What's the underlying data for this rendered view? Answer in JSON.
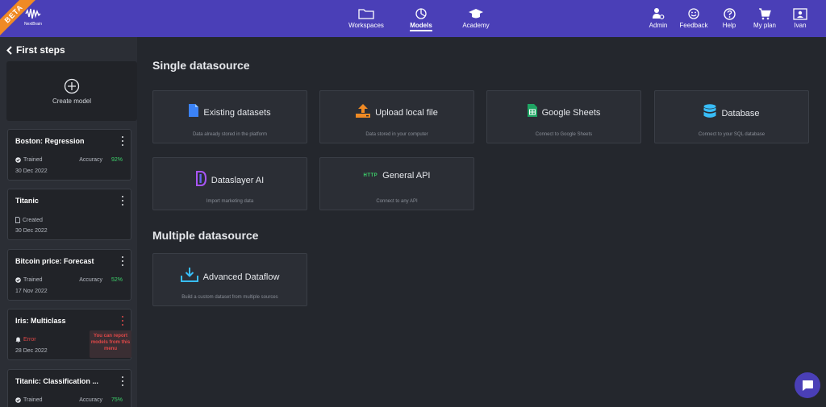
{
  "header": {
    "beta": "BETA",
    "logo_text": "NextBrain",
    "nav": [
      {
        "label": "Workspaces"
      },
      {
        "label": "Models"
      },
      {
        "label": "Academy"
      }
    ],
    "right": [
      {
        "label": "Admin"
      },
      {
        "label": "Feedback"
      },
      {
        "label": "Help"
      },
      {
        "label": "My plan"
      },
      {
        "label": "Ivan"
      }
    ]
  },
  "sidebar": {
    "title": "First steps",
    "create_label": "Create model",
    "models": [
      {
        "name": "Boston: Regression",
        "status": "Trained",
        "accuracy_label": "Accuracy",
        "accuracy": "92%",
        "date": "30 Dec 2022"
      },
      {
        "name": "Titanic",
        "status": "Created",
        "accuracy_label": "",
        "accuracy": "",
        "date": "30 Dec 2022"
      },
      {
        "name": "Bitcoin price: Forecast",
        "status": "Trained",
        "accuracy_label": "Accuracy",
        "accuracy": "52%",
        "date": "17 Nov 2022"
      },
      {
        "name": "Iris: Multiclass",
        "status": "Error",
        "accuracy_label": "",
        "accuracy": "",
        "date": "28 Dec 2022"
      },
      {
        "name": "Titanic: Classification ...",
        "status": "Trained",
        "accuracy_label": "Accuracy",
        "accuracy": "75%",
        "date": ""
      }
    ],
    "tooltip": "You can report models from this menu"
  },
  "main": {
    "single_title": "Single datasource",
    "multiple_title": "Multiple datasource",
    "single": [
      {
        "title": "Existing datasets",
        "sub": "Data already stored in the platform"
      },
      {
        "title": "Upload local file",
        "sub": "Data stored in your computer"
      },
      {
        "title": "Google Sheets",
        "sub": "Connect to Google Sheets"
      },
      {
        "title": "Database",
        "sub": "Connect to your SQL database"
      },
      {
        "title": "Dataslayer AI",
        "sub": "Import marketing data"
      },
      {
        "title": "General API",
        "sub": "Connect to any API",
        "badge": "HTTP"
      }
    ],
    "multiple": [
      {
        "title": "Advanced Dataflow",
        "sub": "Build a custom dataset from multiple sources"
      }
    ]
  },
  "colors": {
    "header": "#4a3fb7",
    "beta": "#f08a24",
    "accuracy": "#3dd26b",
    "error": "#e04848"
  }
}
